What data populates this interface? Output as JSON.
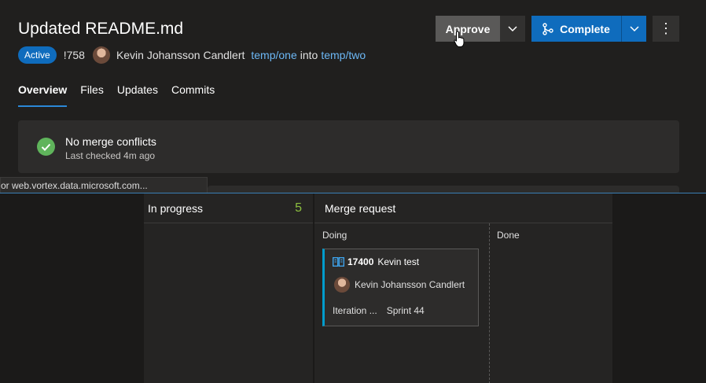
{
  "pr": {
    "title": "Updated README.md",
    "status_badge": "Active",
    "id": "!758",
    "author": "Kevin Johansson Candlert",
    "source_branch": "temp/one",
    "into_text": "into",
    "target_branch": "temp/two"
  },
  "actions": {
    "approve_label": "Approve",
    "complete_label": "Complete",
    "more_glyph": "⋮"
  },
  "tabs": [
    {
      "label": "Overview",
      "active": true
    },
    {
      "label": "Files",
      "active": false
    },
    {
      "label": "Updates",
      "active": false
    },
    {
      "label": "Commits",
      "active": false
    }
  ],
  "merge_status": {
    "title": "No merge conflicts",
    "subtitle": "Last checked 4m ago"
  },
  "tooltip": {
    "url_text": "or web.vortex.data.microsoft.com..."
  },
  "board": {
    "columns": [
      {
        "name": "In progress",
        "count": "5"
      },
      {
        "name": "Merge request"
      }
    ],
    "sub_columns": [
      "Doing",
      "Done"
    ],
    "card": {
      "id": "17400",
      "title": "Kevin test",
      "assignee": "Kevin Johansson Candlert",
      "field_label": "Iteration ...",
      "field_value": "Sprint 44"
    }
  },
  "colors": {
    "accent": "#0f6cbd",
    "success": "#5fb45b",
    "card_stripe": "#009ccc",
    "count": "#8cbf3f"
  }
}
